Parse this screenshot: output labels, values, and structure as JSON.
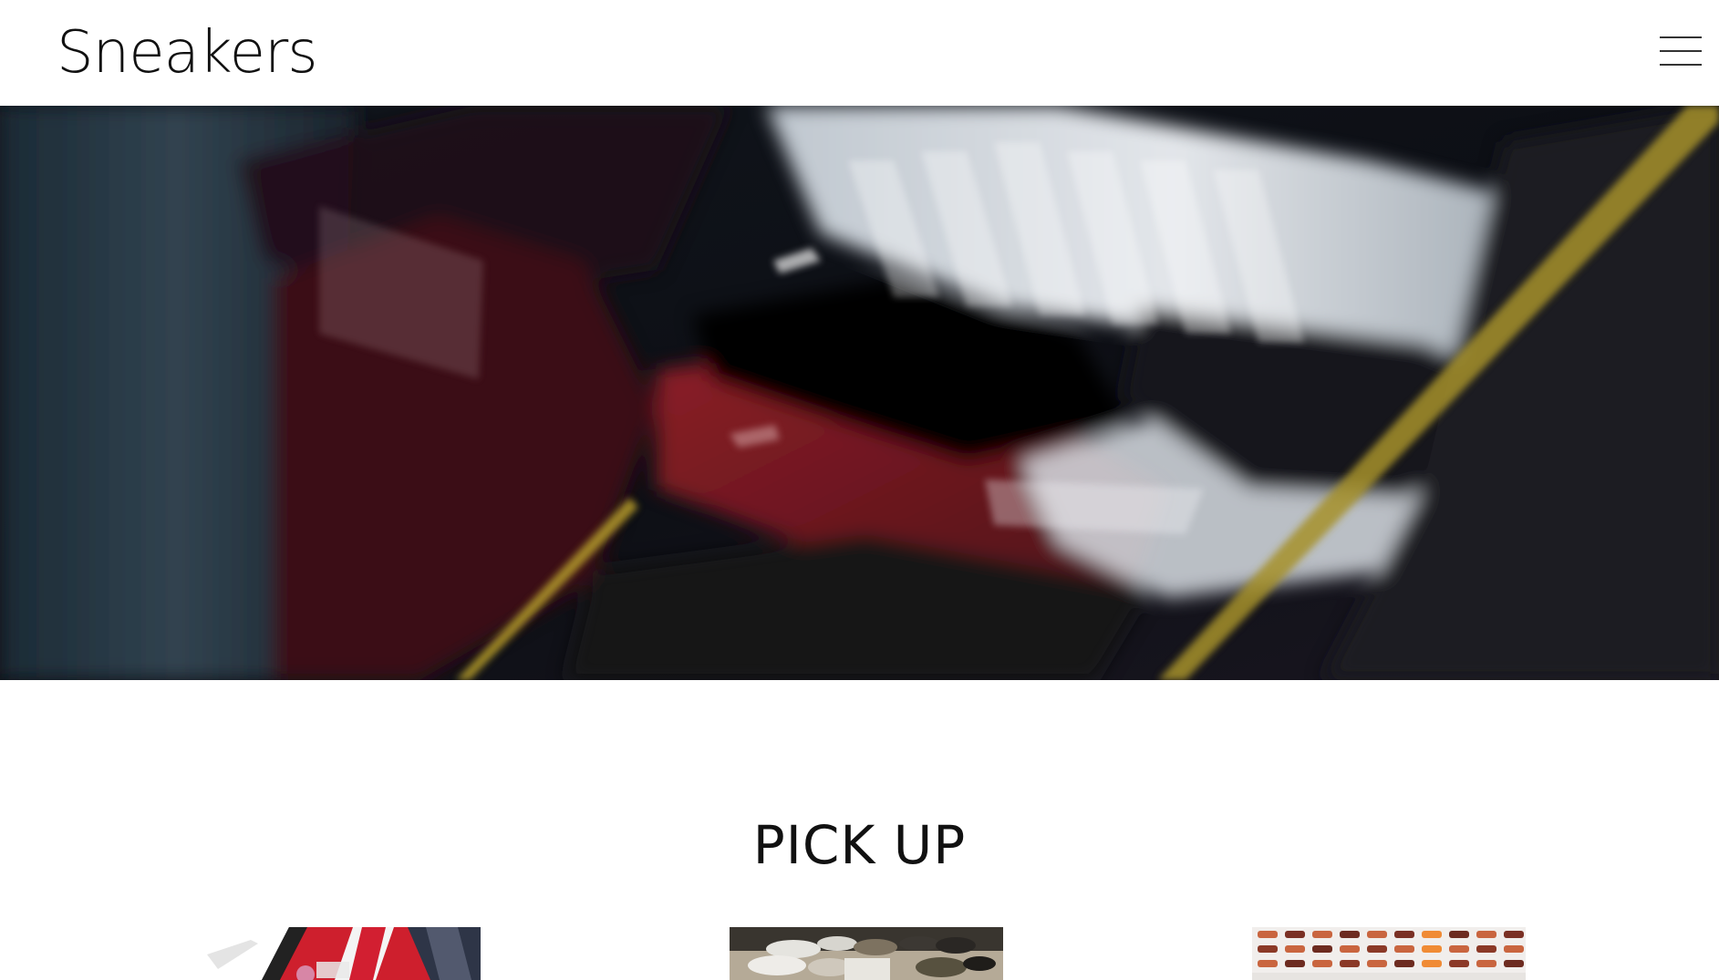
{
  "header": {
    "logo_text": "Sneakers",
    "menu_icon": "hamburger-menu-icon"
  },
  "hero": {
    "image": "blurred close-up sneaker photo",
    "colors": {
      "dark": "#0f1218",
      "red": "#7d1b22",
      "white": "#d8dde2",
      "stripe": "#b39a2a"
    }
  },
  "pickup": {
    "title": "PICK UP",
    "cards": [
      {
        "image": "sneaker-box-red-photo"
      },
      {
        "image": "sneakers-on-floor-photo"
      },
      {
        "image": "sneakers-grid-photo"
      }
    ]
  }
}
